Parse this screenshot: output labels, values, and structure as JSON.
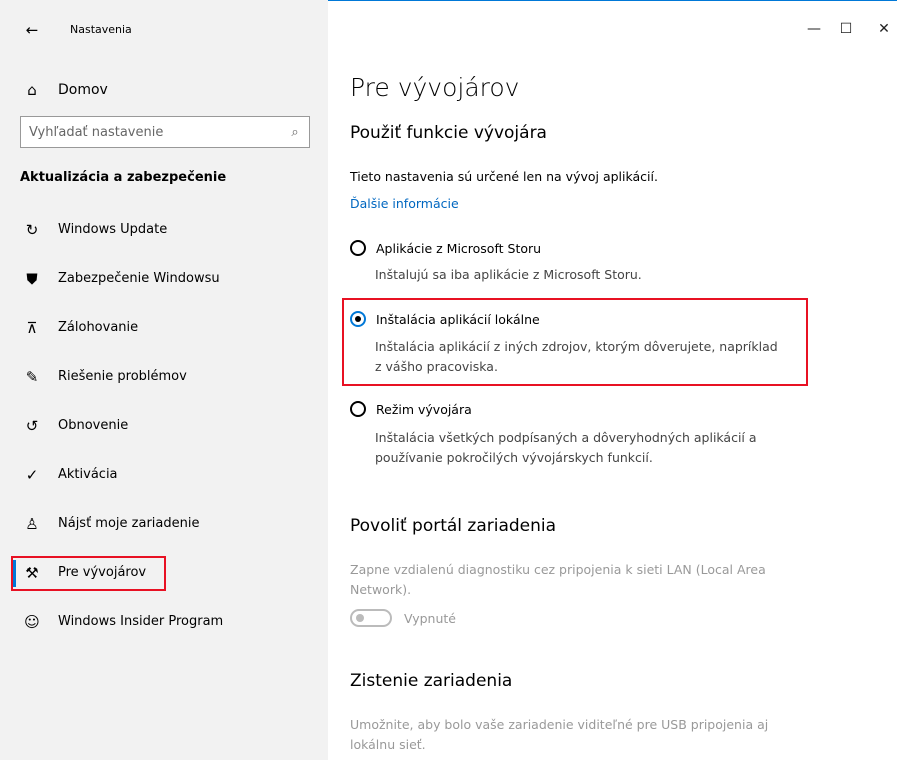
{
  "window": {
    "app_title": "Nastavenia",
    "back_icon": "←",
    "minimize": "—",
    "maximize": "☐",
    "close": "✕"
  },
  "sidebar": {
    "home": {
      "icon": "⌂",
      "label": "Domov"
    },
    "search": {
      "placeholder": "Vyhľadať nastavenie",
      "icon": "⌕"
    },
    "section_title": "Aktualizácia a zabezpečenie",
    "items": [
      {
        "label": "Windows Update",
        "icon": "↻",
        "icon_name": "refresh-icon"
      },
      {
        "label": "Zabezpečenie Windowsu",
        "icon": "⛊",
        "icon_name": "shield-icon"
      },
      {
        "label": "Zálohovanie",
        "icon": "⊼",
        "icon_name": "backup-icon"
      },
      {
        "label": "Riešenie problémov",
        "icon": "✎",
        "icon_name": "wrench-icon"
      },
      {
        "label": "Obnovenie",
        "icon": "↺",
        "icon_name": "recovery-icon"
      },
      {
        "label": "Aktivácia",
        "icon": "✓",
        "icon_name": "check-circle-icon"
      },
      {
        "label": "Nájsť moje zariadenie",
        "icon": "♙",
        "icon_name": "person-location-icon"
      },
      {
        "label": "Pre vývojárov",
        "icon": "⚒",
        "icon_name": "developer-tools-icon",
        "selected": true
      },
      {
        "label": "Windows Insider Program",
        "icon": "☺",
        "icon_name": "insider-cat-icon"
      }
    ],
    "accent_color": "#0078d7",
    "highlight_color": "#e81123"
  },
  "main": {
    "page_title": "Pre vývojárov",
    "dev_section": {
      "title": "Použiť funkcie vývojára",
      "description": "Tieto nastavenia sú určené len na vývoj aplikácií.",
      "link": "Ďalšie informácie",
      "options": [
        {
          "label": "Aplikácie z Microsoft Storu",
          "desc1": "Inštalujú sa iba aplikácie z Microsoft Storu.",
          "desc2": "",
          "selected": false
        },
        {
          "label": "Inštalácia aplikácií lokálne",
          "desc1": "Inštalácia aplikácií z iných zdrojov, ktorým dôverujete, napríklad",
          "desc2": "z vášho pracoviska.",
          "selected": true
        },
        {
          "label": "Režim vývojára",
          "desc1": "Inštalácia všetkých podpísaných a dôveryhodných aplikácií a",
          "desc2": "používanie pokročilých vývojárskych funkcií.",
          "selected": false
        }
      ]
    },
    "portal_section": {
      "title": "Povoliť portál zariadenia",
      "desc1": "Zapne vzdialenú diagnostiku cez pripojenia k sieti LAN (Local Area",
      "desc2": "Network).",
      "toggle_label": "Vypnuté"
    },
    "discovery_section": {
      "title": "Zistenie zariadenia",
      "desc1": "Umožnite, aby bolo vaše zariadenie viditeľné pre USB pripojenia aj",
      "desc2": "lokálnu sieť."
    }
  }
}
